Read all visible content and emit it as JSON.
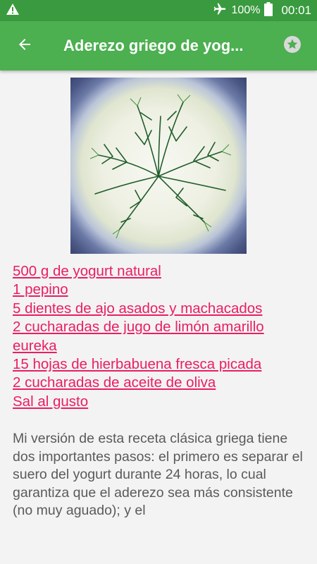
{
  "status_bar": {
    "battery": "100%",
    "time": "00:01",
    "icons": [
      "warning-icon",
      "airplane-mode-icon",
      "battery-icon"
    ]
  },
  "app_bar": {
    "title": "Aderezo griego de yog...",
    "back_icon": "arrow-left-icon",
    "favorite_icon": "star-icon",
    "color": "#4caf50",
    "status_color": "#3a9a3f"
  },
  "recipe": {
    "image_alt": "tzatziki-with-dill",
    "ingredients": [
      "500 g de yogurt natural",
      "1 pepino",
      "5 dientes de ajo asados y machacados",
      "2 cucharadas de jugo de limón amarillo eureka",
      "15 hojas de hierbabuena fresca picada",
      "2 cucharadas de aceite de oliva",
      "Sal al gusto"
    ],
    "ingredient_color": "#e91e63",
    "description": "Mi versión de esta receta clásica griega tiene dos importantes pasos: el primero es separar el suero del yogurt durante 24 horas, lo cual garantiza que el aderezo sea más consistente (no muy aguado); y el"
  }
}
